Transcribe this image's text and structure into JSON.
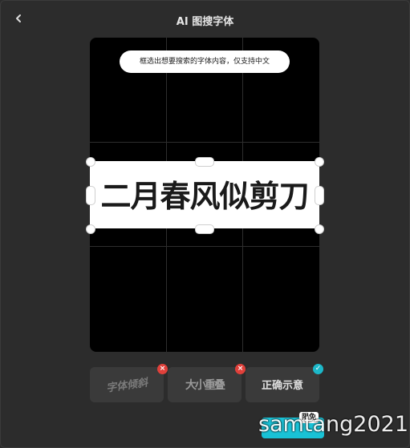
{
  "header": {
    "title": "AI 图搜字体",
    "back_icon": "chevron-left-icon"
  },
  "canvas": {
    "hint": "框选出想要搜索的字体内容，仅支持中文",
    "crop_text": "二月春风似剪刀"
  },
  "samples": [
    {
      "label": "字体倾斜",
      "status": "incorrect",
      "badge": "×"
    },
    {
      "label": "大小重叠",
      "status": "incorrect",
      "badge": "×"
    },
    {
      "label": "正确示意",
      "status": "correct",
      "badge": "✓"
    }
  ],
  "cta": {
    "badge": "限免"
  },
  "watermark": "samtang2021",
  "colors": {
    "accent": "#19c2d6",
    "error": "#e0403a",
    "background": "#2c2c2c"
  }
}
